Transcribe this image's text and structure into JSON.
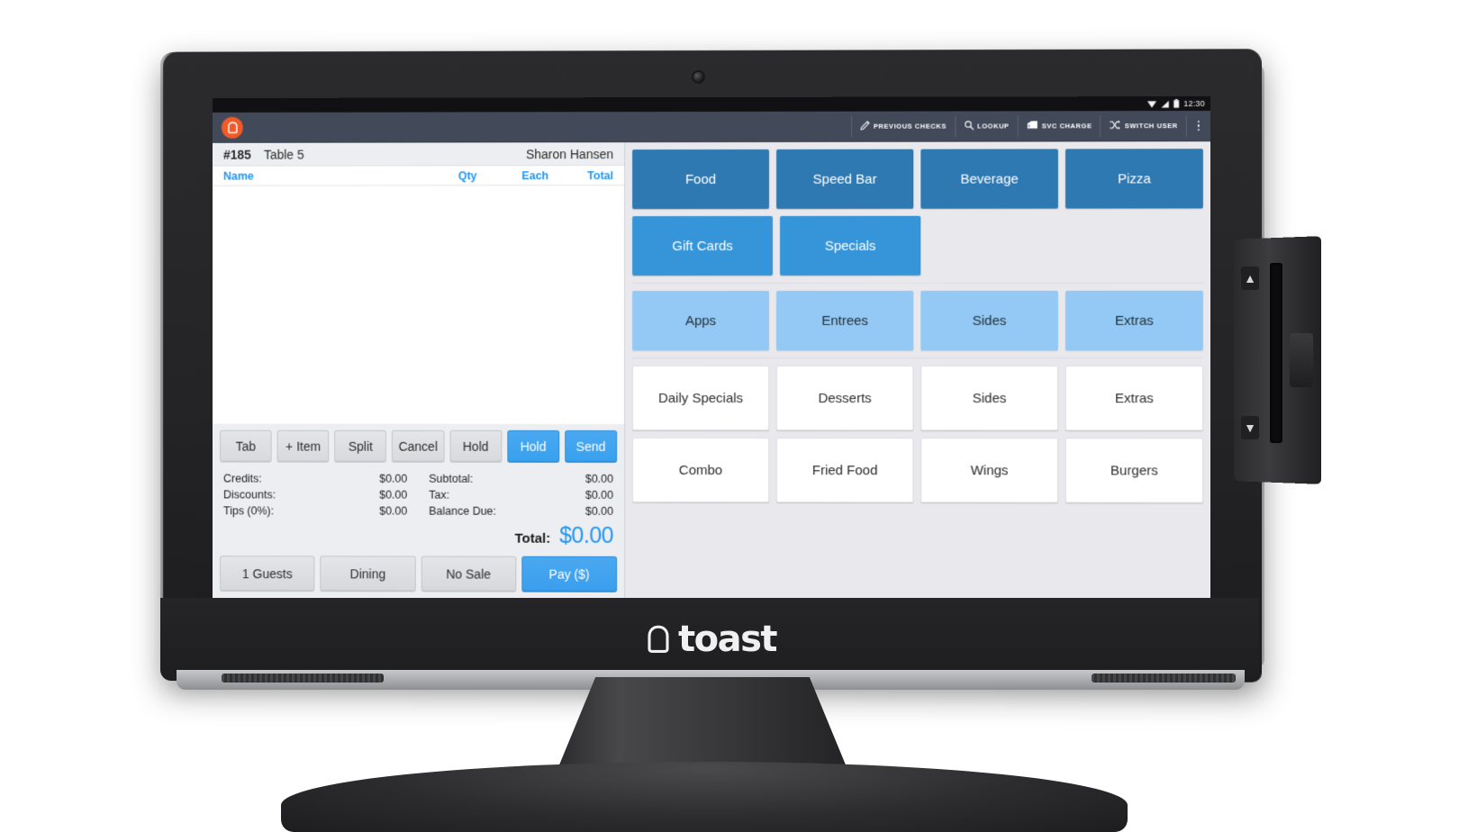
{
  "status_bar": {
    "time": "12:30",
    "icons": [
      "wifi-icon",
      "signal-icon",
      "battery-icon"
    ]
  },
  "app_bar": {
    "logo": "toast-logo-icon",
    "actions": [
      {
        "label": "Previous Checks",
        "icon": "pencil-icon"
      },
      {
        "label": "Lookup",
        "icon": "search-icon"
      },
      {
        "label": "Svc Charge",
        "icon": "receipt-icon"
      },
      {
        "label": "Switch User",
        "icon": "shuffle-icon"
      }
    ],
    "overflow": "more-options-icon"
  },
  "check": {
    "number": "#185",
    "table": "Table 5",
    "server": "Sharon Hansen",
    "columns": {
      "name": "Name",
      "qty": "Qty",
      "each": "Each",
      "total": "Total"
    },
    "items": [],
    "actions": [
      {
        "label": "Tab",
        "style": "default"
      },
      {
        "label": "+ Item",
        "style": "default"
      },
      {
        "label": "Split",
        "style": "default"
      },
      {
        "label": "Cancel",
        "style": "default"
      },
      {
        "label": "Hold",
        "style": "default"
      },
      {
        "label": "Hold",
        "style": "primary"
      },
      {
        "label": "Send",
        "style": "primary"
      }
    ],
    "totals_left": [
      {
        "label": "Credits:",
        "value": "$0.00"
      },
      {
        "label": "Discounts:",
        "value": "$0.00"
      },
      {
        "label": "Tips (0%):",
        "value": "$0.00"
      }
    ],
    "totals_right": [
      {
        "label": "Subtotal:",
        "value": "$0.00"
      },
      {
        "label": "Tax:",
        "value": "$0.00"
      },
      {
        "label": "Balance Due:",
        "value": "$0.00"
      }
    ],
    "grand_total_label": "Total:",
    "grand_total_value": "$0.00",
    "bottom_actions": [
      {
        "label": "1 Guests",
        "style": "default"
      },
      {
        "label": "Dining",
        "style": "default"
      },
      {
        "label": "No Sale",
        "style": "default"
      },
      {
        "label": "Pay ($)",
        "style": "pay"
      }
    ]
  },
  "menu": {
    "level1": [
      "Food",
      "Speed Bar",
      "Beverage",
      "Pizza"
    ],
    "level1b": [
      "Gift Cards",
      "Specials"
    ],
    "level2": [
      "Apps",
      "Entrees",
      "Sides",
      "Extras"
    ],
    "level3_row1": [
      "Daily Specials",
      "Desserts",
      "Sides",
      "Extras"
    ],
    "level3_row2": [
      "Combo",
      "Fried Food",
      "Wings",
      "Burgers"
    ]
  },
  "device": {
    "brand": "toast",
    "brand_icon": "toast-bread-icon"
  },
  "colors": {
    "accent_blue": "#2196f3",
    "brand_orange": "#f05a28",
    "level1_blue": "#2e79b1",
    "level1b_blue": "#3595d8",
    "level2_blue": "#93c9f4",
    "app_bar": "#424a59"
  }
}
